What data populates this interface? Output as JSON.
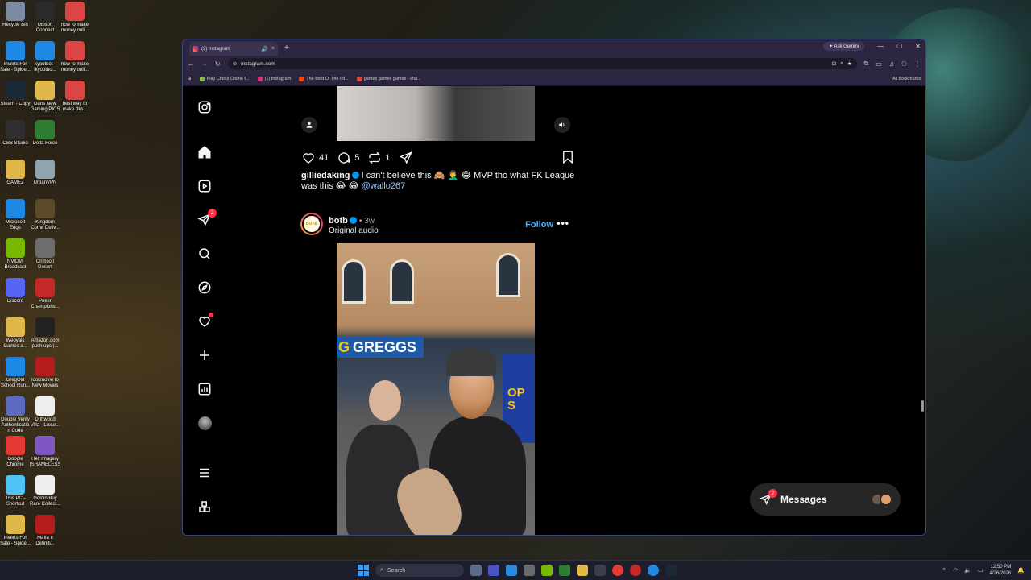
{
  "desktop": {
    "icons": [
      {
        "label": "Recycle Bin",
        "color": "#7a8aa0"
      },
      {
        "label": "Ubisoft Connect",
        "color": "#2a2a2a"
      },
      {
        "label": "how to make money onli...",
        "color": "#d44"
      },
      {
        "label": "Inverts For Sale - Spide...",
        "color": "#1e88e5"
      },
      {
        "label": "kyootbot - lkyootbo...",
        "color": "#1e88e5"
      },
      {
        "label": "how to make money onli...",
        "color": "#d44"
      },
      {
        "label": "Steam - Copy",
        "color": "#1b2838"
      },
      {
        "label": "Dans New Gaming PICS",
        "color": "#e0b84a"
      },
      {
        "label": "best way to make 3ks...",
        "color": "#d44"
      },
      {
        "label": "OBS Studio",
        "color": "#302e31"
      },
      {
        "label": "Delta Force",
        "color": "#2e7d32"
      },
      {
        "label": "GAMEZ",
        "color": "#e0b84a"
      },
      {
        "label": "UrbanVPN",
        "color": "#90a4ae"
      },
      {
        "label": "Microsoft Edge",
        "color": "#1e88e5"
      },
      {
        "label": "Kingdom Come Deliv...",
        "color": "#5d4a2a"
      },
      {
        "label": "NVIDIA Broadcast",
        "color": "#76b900"
      },
      {
        "label": "Crimson Desert",
        "color": "#6d6d6d"
      },
      {
        "label": "Discord",
        "color": "#5865f2"
      },
      {
        "label": "Poker Champions...",
        "color": "#c62828"
      },
      {
        "label": "Weoyals Games a...",
        "color": "#e0b84a"
      },
      {
        "label": "Amazon.com push ups (...",
        "color": "#222"
      },
      {
        "label": "GregOld School Run...",
        "color": "#1e88e5"
      },
      {
        "label": "lookmovie to New Movies",
        "color": "#b71c1c"
      },
      {
        "label": "Double Verify Authenticatio n Code",
        "color": "#5c6bc0"
      },
      {
        "label": "Driftwood Villa - Luxur...",
        "color": "#eee"
      },
      {
        "label": "Google Chrome",
        "color": "#e53935"
      },
      {
        "label": "Hell Imagery [SHAMELESS]",
        "color": "#7e57c2"
      },
      {
        "label": "This PC - Shortcut",
        "color": "#4fc3f7"
      },
      {
        "label": "Goldin Buy Rare Collect...",
        "color": "#eee"
      },
      {
        "label": "Inverts For Sale - Spide...",
        "color": "#e0b84a"
      },
      {
        "label": "Mafia II Definiti...",
        "color": "#b71c1c"
      }
    ]
  },
  "browser": {
    "tab_title": "(2) Instagram",
    "new_tab": "+",
    "ask_gemini": "Ask Gemini",
    "url": "instagram.com",
    "bookmarks": [
      {
        "label": "Play Chess Online f...",
        "color": "#81b64c"
      },
      {
        "label": "(1) Instagram",
        "color": "#e1306c"
      },
      {
        "label": "The Best Of The Int...",
        "color": "#ff4500"
      },
      {
        "label": "games games games - sha...",
        "color": "#ea4335"
      }
    ],
    "all_bookmarks": "All Bookmarks"
  },
  "sidebar": {
    "notifications_badge": "2"
  },
  "post1": {
    "likes": "41",
    "comments": "5",
    "reposts": "1",
    "username": "gilliedaking",
    "caption": "I can't believe this 🙈 🤦‍♂️ 😂 MVP tho what FK Leaque was this 😂 😂",
    "mention": "@wallo267"
  },
  "post2": {
    "username": "botb",
    "avatar_text": "BOTB",
    "time": "• 3w",
    "audio": "Original audio",
    "follow": "Follow",
    "more": "•••",
    "shop_sign": "GREGGS",
    "wall_text": "OP S"
  },
  "messages": {
    "label": "Messages",
    "badge": "2"
  },
  "taskbar": {
    "search_placeholder": "Search",
    "time": "12:50 PM",
    "date": "4/26/2026"
  }
}
